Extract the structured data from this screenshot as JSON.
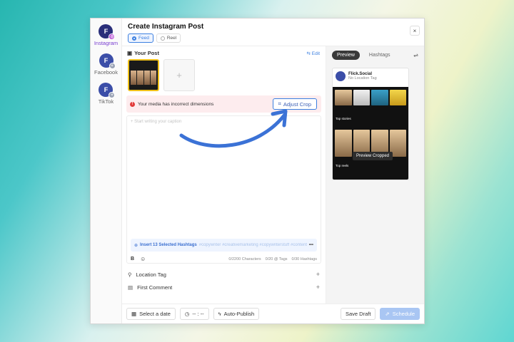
{
  "rail": {
    "networks": [
      {
        "label": "Instagram",
        "active": true
      },
      {
        "label": "Facebook",
        "active": false
      },
      {
        "label": "TikTok",
        "active": false
      }
    ]
  },
  "header": {
    "title": "Create Instagram Post",
    "type_options": [
      "Feed",
      "Reel"
    ],
    "close_glyph": "×"
  },
  "post": {
    "section_title": "Your Post",
    "edit_label": "Edit",
    "add_glyph": "+"
  },
  "warning": {
    "message": "Your media has incorrect dimensions",
    "adjust_label": "Adjust Crop"
  },
  "caption": {
    "placeholder": "+ Start writing your caption",
    "insert_hashtags": "Insert 13 Selected Hashtags",
    "hashtags_preview": "#copywriter #creativemarketing #copywriterstuff #contentwriting",
    "more_glyph": "•••",
    "bold": "B",
    "characters": "0/2200 Characters",
    "tags": "0/20 @ Tags",
    "hashtags_count": "0/30 Hashtags"
  },
  "fields": {
    "location_tag": "Location Tag",
    "first_comment": "First Comment",
    "plus": "+"
  },
  "bottom": {
    "select_date": "Select a date",
    "time": "-- : --",
    "auto_publish": "Auto-Publish",
    "save_draft": "Save Draft",
    "schedule": "Schedule"
  },
  "preview_panel": {
    "tabs": [
      "Preview",
      "Hashtags"
    ],
    "account_name": "Flick.Social",
    "location": "No Location Tag",
    "stories_label": "Tap stories",
    "reels_label": "Top reels",
    "preview_cropped": "Preview Cropped"
  },
  "colors": {
    "accent": "#3b7fe0",
    "warning_bg": "#fdecee",
    "arrow": "#3b72d6"
  }
}
